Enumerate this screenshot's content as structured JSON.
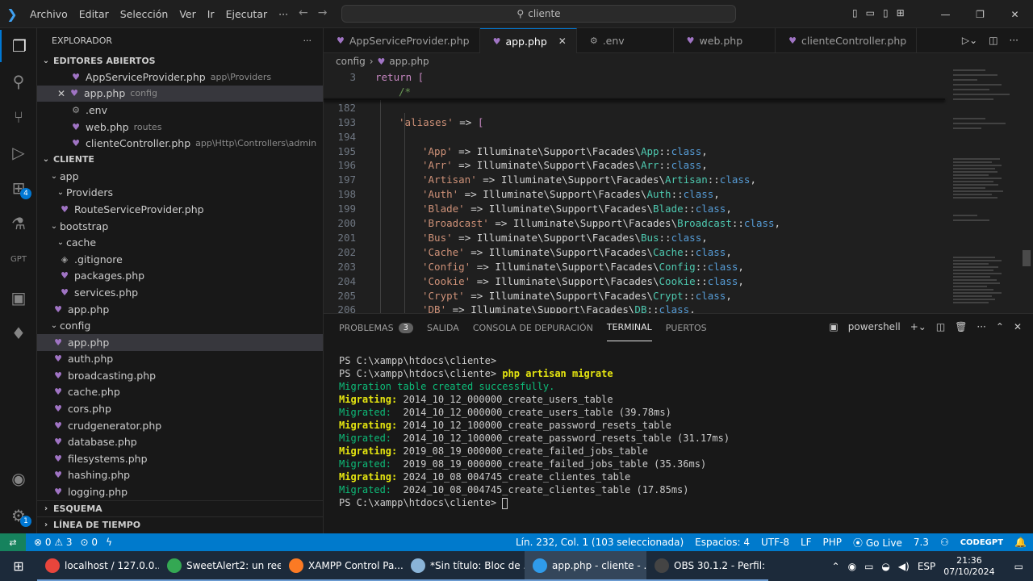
{
  "titlebar": {
    "menu": [
      "Archivo",
      "Editar",
      "Selección",
      "Ver",
      "Ir",
      "Ejecutar",
      "···"
    ],
    "search": "cliente"
  },
  "activitybar": {
    "extensions_badge": "4",
    "accounts_badge": "1"
  },
  "sidebar": {
    "title": "EXPLORADOR",
    "open_editors_label": "EDITORES ABIERTOS",
    "open_editors": [
      {
        "name": "AppServiceProvider.php",
        "desc": "app\\Providers"
      },
      {
        "name": "app.php",
        "desc": "config"
      },
      {
        "name": ".env",
        "desc": ""
      },
      {
        "name": "web.php",
        "desc": "routes"
      },
      {
        "name": "clienteController.php",
        "desc": "app\\Http\\Controllers\\admin"
      }
    ],
    "project_label": "CLIENTE",
    "tree": {
      "app": "app",
      "providers": "Providers",
      "route_provider": "RouteServiceProvider.php",
      "bootstrap": "bootstrap",
      "cache": "cache",
      "gitignore": ".gitignore",
      "packages": "packages.php",
      "services": "services.php",
      "bootstrap_app": "app.php",
      "config": "config",
      "config_files": [
        "app.php",
        "auth.php",
        "broadcasting.php",
        "cache.php",
        "cors.php",
        "crudgenerator.php",
        "database.php",
        "filesystems.php",
        "hashing.php",
        "logging.php"
      ]
    },
    "outline_label": "ESQUEMA",
    "timeline_label": "LÍNEA DE TIEMPO"
  },
  "tabs": [
    {
      "name": "AppServiceProvider.php"
    },
    {
      "name": "app.php"
    },
    {
      "name": ".env"
    },
    {
      "name": "web.php"
    },
    {
      "name": "clienteController.php"
    }
  ],
  "breadcrumb": {
    "folder": "config",
    "file": "app.php"
  },
  "editor": {
    "sticky": [
      {
        "ln": "3",
        "text": "return ["
      },
      {
        "ln": "",
        "text": "/*"
      }
    ],
    "line_182": "182",
    "line_193": "193",
    "line_194": "194",
    "aliases_key": "'aliases'",
    "namespace": "Illuminate\\Support\\Facades\\",
    "aliases": [
      {
        "ln": "195",
        "key": "'App'",
        "cls": "App"
      },
      {
        "ln": "196",
        "key": "'Arr'",
        "cls": "Arr"
      },
      {
        "ln": "197",
        "key": "'Artisan'",
        "cls": "Artisan"
      },
      {
        "ln": "198",
        "key": "'Auth'",
        "cls": "Auth"
      },
      {
        "ln": "199",
        "key": "'Blade'",
        "cls": "Blade"
      },
      {
        "ln": "200",
        "key": "'Broadcast'",
        "cls": "Broadcast"
      },
      {
        "ln": "201",
        "key": "'Bus'",
        "cls": "Bus"
      },
      {
        "ln": "202",
        "key": "'Cache'",
        "cls": "Cache"
      },
      {
        "ln": "203",
        "key": "'Config'",
        "cls": "Config"
      },
      {
        "ln": "204",
        "key": "'Cookie'",
        "cls": "Cookie"
      },
      {
        "ln": "205",
        "key": "'Crypt'",
        "cls": "Crypt"
      },
      {
        "ln": "206",
        "key": "'DB'",
        "cls": "DB"
      }
    ]
  },
  "panel": {
    "tabs": [
      "PROBLEMAS",
      "SALIDA",
      "CONSOLA DE DEPURACIÓN",
      "TERMINAL",
      "PUERTOS"
    ],
    "problems_count": "3",
    "shell": "powershell"
  },
  "terminal": {
    "prompt": "PS C:\\xampp\\htdocs\\cliente>",
    "command": "php artisan migrate",
    "created": "Migration table created successfully.",
    "migrating_label": "Migrating:",
    "migrated_label": "Migrated:",
    "steps": [
      {
        "kind": "migrating",
        "text": "2014_10_12_000000_create_users_table"
      },
      {
        "kind": "migrated",
        "text": "2014_10_12_000000_create_users_table (39.78ms)"
      },
      {
        "kind": "migrating",
        "text": "2014_10_12_100000_create_password_resets_table"
      },
      {
        "kind": "migrated",
        "text": "2014_10_12_100000_create_password_resets_table (31.17ms)"
      },
      {
        "kind": "migrating",
        "text": "2019_08_19_000000_create_failed_jobs_table"
      },
      {
        "kind": "migrated",
        "text": "2019_08_19_000000_create_failed_jobs_table (35.36ms)"
      },
      {
        "kind": "migrating",
        "text": "2024_10_08_004745_create_clientes_table"
      },
      {
        "kind": "migrated",
        "text": "2024_10_08_004745_create_clientes_table (17.85ms)"
      }
    ]
  },
  "statusbar": {
    "errors": "0",
    "warnings": "3",
    "ports": "0",
    "position": "Lín. 232, Col. 1 (103 seleccionada)",
    "spaces": "Espacios: 4",
    "encoding": "UTF-8",
    "eol": "LF",
    "language": "PHP",
    "golive": "Go Live",
    "version": "7.3",
    "codegpt": "CODEGPT"
  },
  "taskbar": {
    "apps": [
      {
        "label": "localhost / 127.0.0....",
        "color": "#e8453c"
      },
      {
        "label": "SweetAlert2: un ree...",
        "color": "#34a853"
      },
      {
        "label": "XAMPP Control Pa...",
        "color": "#fb7a24"
      },
      {
        "label": "*Sin título: Bloc de ...",
        "color": "#8ab4d8"
      },
      {
        "label": "app.php - cliente - ...",
        "color": "#2f9bea"
      },
      {
        "label": "OBS 30.1.2 - Perfil: ...",
        "color": "#444444"
      }
    ],
    "lang": "ESP",
    "time": "21:36",
    "date": "07/10/2024"
  }
}
